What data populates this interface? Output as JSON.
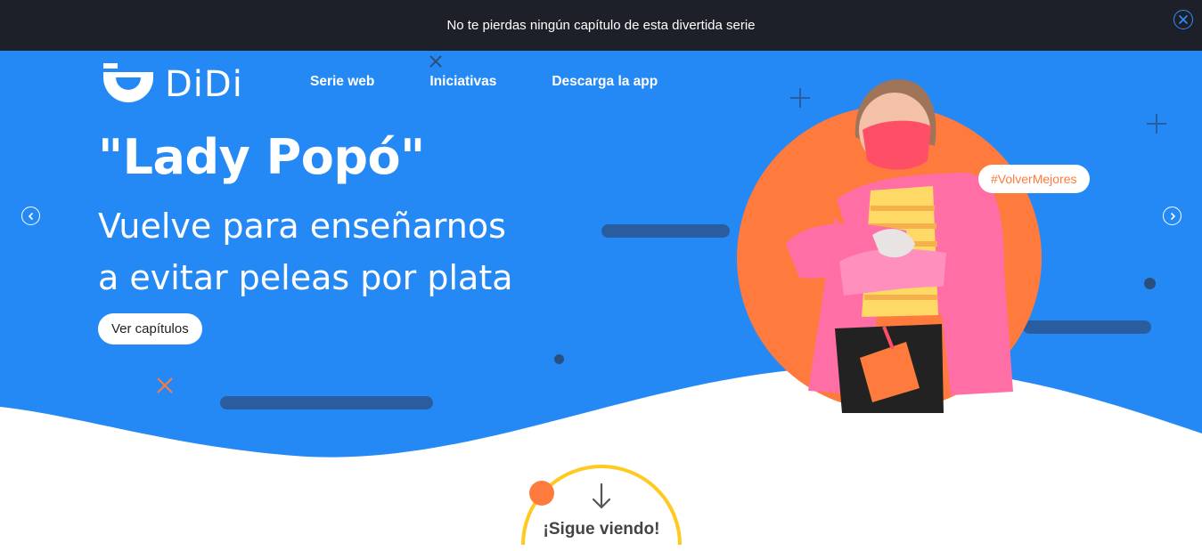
{
  "announcement": {
    "text": "No te pierdas ningún capítulo de esta divertida serie",
    "close_icon": "close-icon"
  },
  "logo": {
    "text": "DiDi"
  },
  "nav": {
    "items": [
      {
        "label": "Serie web"
      },
      {
        "label": "Iniciativas"
      },
      {
        "label": "Descarga la app"
      }
    ]
  },
  "hero": {
    "title": "\"Lady Popó\"",
    "subtitle_line1": "Vuelve para enseñarnos",
    "subtitle_line2": "a evitar peleas por plata",
    "cta_label": "Ver capítulos",
    "tag": "#VolverMejores",
    "prev_icon": "chevron-left-icon",
    "next_icon": "chevron-right-icon"
  },
  "scroll_hint": {
    "label": "¡Sigue viendo!",
    "icon": "arrow-down-icon"
  },
  "colors": {
    "announcement_bg": "#1e2029",
    "hero_blue": "#2589f5",
    "accent_orange": "#ff7a3d",
    "accent_yellow": "#ffc91f",
    "dark_stroke": "#2a5da0",
    "close_icon": "#2e8cff"
  }
}
